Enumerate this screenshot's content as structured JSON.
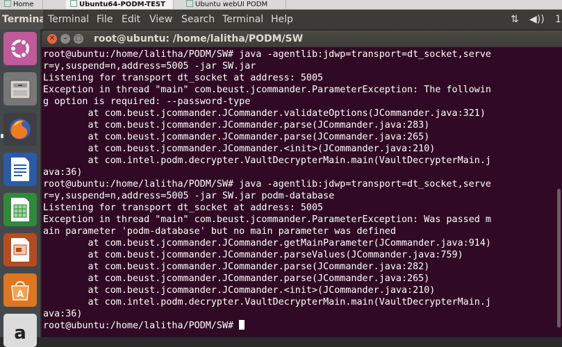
{
  "host_tabs": [
    {
      "label": "Home",
      "active": false
    },
    {
      "label": "Ubuntu64-PODM-TEST",
      "active": true
    },
    {
      "label": "Ubuntu webUI PODM",
      "active": false
    }
  ],
  "panel": {
    "app_name": "Terminal",
    "menus": [
      "Terminal",
      "File",
      "Edit",
      "View",
      "Search",
      "Terminal",
      "Help"
    ],
    "indicators": {
      "network": "⇅",
      "sound": "◀))",
      "clock": "1"
    }
  },
  "launcher": {
    "items": [
      {
        "name": "ubuntu-dash-icon"
      },
      {
        "name": "files-icon"
      },
      {
        "name": "firefox-icon"
      },
      {
        "name": "libreoffice-writer-icon"
      },
      {
        "name": "libreoffice-calc-icon"
      },
      {
        "name": "libreoffice-impress-icon"
      },
      {
        "name": "software-center-icon"
      },
      {
        "name": "amazon-icon"
      }
    ]
  },
  "window": {
    "title": "root@ubuntu: /home/lalitha/PODM/SW",
    "close_glyph": "✕",
    "min_glyph": "–",
    "max_glyph": "□"
  },
  "terminal": {
    "lines": [
      "root@ubuntu:/home/lalitha/PODM/SW# java -agentlib:jdwp=transport=dt_socket,serve",
      "r=y,suspend=n,address=5005 -jar SW.jar",
      "Listening for transport dt_socket at address: 5005",
      "Exception in thread \"main\" com.beust.jcommander.ParameterException: The followin",
      "g option is required: --password-type",
      "        at com.beust.jcommander.JCommander.validateOptions(JCommander.java:321)",
      "        at com.beust.jcommander.JCommander.parse(JCommander.java:283)",
      "        at com.beust.jcommander.JCommander.parse(JCommander.java:265)",
      "        at com.beust.jcommander.JCommander.<init>(JCommander.java:210)",
      "        at com.intel.podm.decrypter.VaultDecrypterMain.main(VaultDecrypterMain.j",
      "ava:36)",
      "root@ubuntu:/home/lalitha/PODM/SW# java -agentlib:jdwp=transport=dt_socket,serve",
      "r=y,suspend=n,address=5005 -jar SW.jar podm-database",
      "Listening for transport dt_socket at address: 5005",
      "Exception in thread \"main\" com.beust.jcommander.ParameterException: Was passed m",
      "ain parameter 'podm-database' but no main parameter was defined",
      "        at com.beust.jcommander.JCommander.getMainParameter(JCommander.java:914)",
      "        at com.beust.jcommander.JCommander.parseValues(JCommander.java:759)",
      "        at com.beust.jcommander.JCommander.parse(JCommander.java:282)",
      "        at com.beust.jcommander.JCommander.parse(JCommander.java:265)",
      "        at com.beust.jcommander.JCommander.<init>(JCommander.java:210)",
      "        at com.intel.podm.decrypter.VaultDecrypterMain.main(VaultDecrypterMain.j",
      "ava:36)"
    ],
    "prompt": "root@ubuntu:/home/lalitha/PODM/SW# "
  },
  "colors": {
    "terminal_bg": "#300a24",
    "terminal_fg": "#ffffff",
    "panel_bg": "#3c3b37",
    "launcher_bg": "#45484b",
    "close_button": "#e9663f"
  }
}
